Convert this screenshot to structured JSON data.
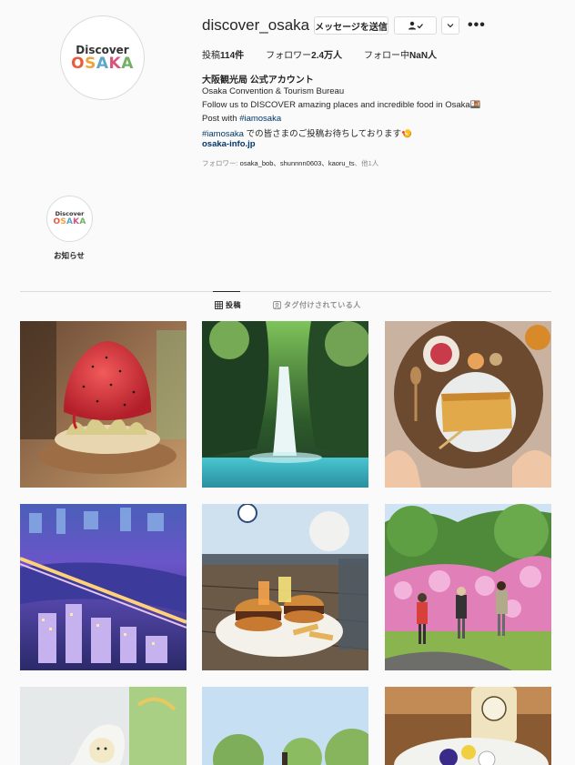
{
  "profile": {
    "username": "discover_osaka",
    "avatar_logo_top": "Discover",
    "avatar_logo_bottom": [
      "O",
      "S",
      "A",
      "K",
      "A"
    ],
    "message_button": "メッセージを送信",
    "follow_icon_label": "👤✓",
    "more_label": "•••",
    "stats": {
      "posts_label": "投稿",
      "posts_value": "114件",
      "followers_label": "フォロワー",
      "followers_value": "2.4万人",
      "following_label": "フォロー中",
      "following_value": "NaN人"
    },
    "full_name": "大阪観光局 公式アカウント",
    "bio": {
      "line1": "Osaka Convention & Tourism Bureau",
      "line2": "Follow us to DISCOVER amazing places and incredible food in Osaka🍱",
      "line3_prefix": "Post with ",
      "line3_tag": "#iamosaka",
      "line4_tag": "#iamosaka",
      "line4_text": " での皆さまのご投稿お待ちしております🍤"
    },
    "link": "osaka-info.jp",
    "followed_by": {
      "prefix": "フォロワー: ",
      "names": "osaka_bob、shunnnn0603、kaoru_ts",
      "suffix": "、他1人"
    }
  },
  "highlights": [
    {
      "label": "お知らせ",
      "logo_top": "Discover",
      "logo_bottom": "OSAKA"
    }
  ],
  "tabs": [
    {
      "label": "投稿",
      "icon": "grid-icon",
      "active": true
    },
    {
      "label": "タグ付けされている人",
      "icon": "tag-icon",
      "active": false
    }
  ],
  "posts": [
    {
      "subject": "kakigori-strawberry-shaved-ice"
    },
    {
      "subject": "waterfall-forest"
    },
    {
      "subject": "breakfast-plate-crepe"
    },
    {
      "subject": "osaka-night-cityscape-river"
    },
    {
      "subject": "burger-fries-waterfront-terrace"
    },
    {
      "subject": "hikers-pink-azalea-hill"
    },
    {
      "subject": "white-dessert-figure"
    },
    {
      "subject": "park-trees-sky"
    },
    {
      "subject": "drink-bottle-flower-plate"
    }
  ],
  "colors": {
    "link": "#00376b",
    "border": "#dbdbdb",
    "muted": "#8e8e8e",
    "text": "#262626",
    "background": "#fafafa"
  }
}
